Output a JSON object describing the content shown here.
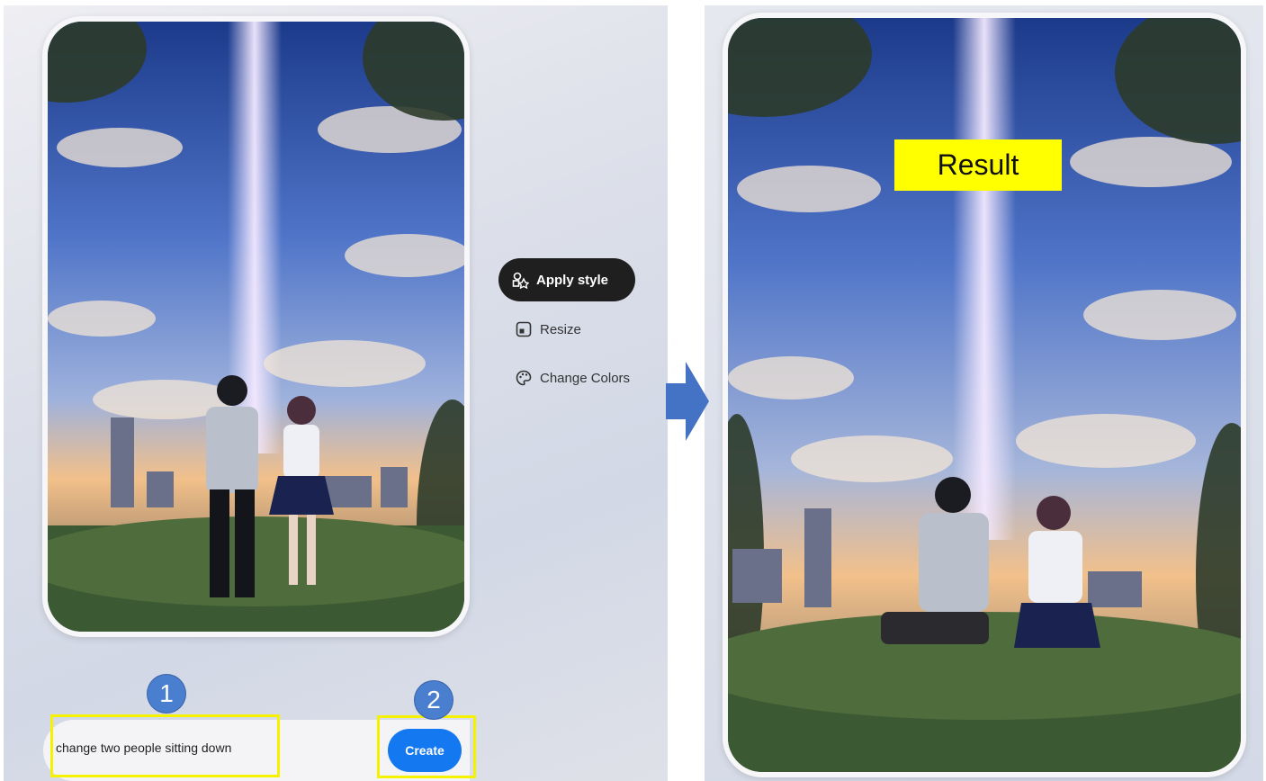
{
  "source_image": {
    "scene": "anime-sky-city",
    "art_colors": {
      "sky_top": "#1c3a8a",
      "sky_mid": "#4f74c8",
      "horizon": "#f2c08a",
      "ground": "#2f4a2a",
      "light_beam": "#f4e9ff"
    }
  },
  "side_menu": {
    "items": [
      {
        "label": "Apply style",
        "icon": "shapes-style-icon",
        "active": true
      },
      {
        "label": "Resize",
        "icon": "resize-icon",
        "active": false
      },
      {
        "label": "Change Colors",
        "icon": "palette-icon",
        "active": false
      }
    ]
  },
  "arrow": {
    "direction": "right",
    "color": "#4472c4"
  },
  "result": {
    "label": "Result",
    "label_bg": "#ffff00"
  },
  "prompt": {
    "value": "change two people sitting down",
    "create_label": "Create",
    "create_color": "#1478f0",
    "step_badges": [
      "1",
      "2"
    ],
    "highlight_color": "#f5f200"
  }
}
